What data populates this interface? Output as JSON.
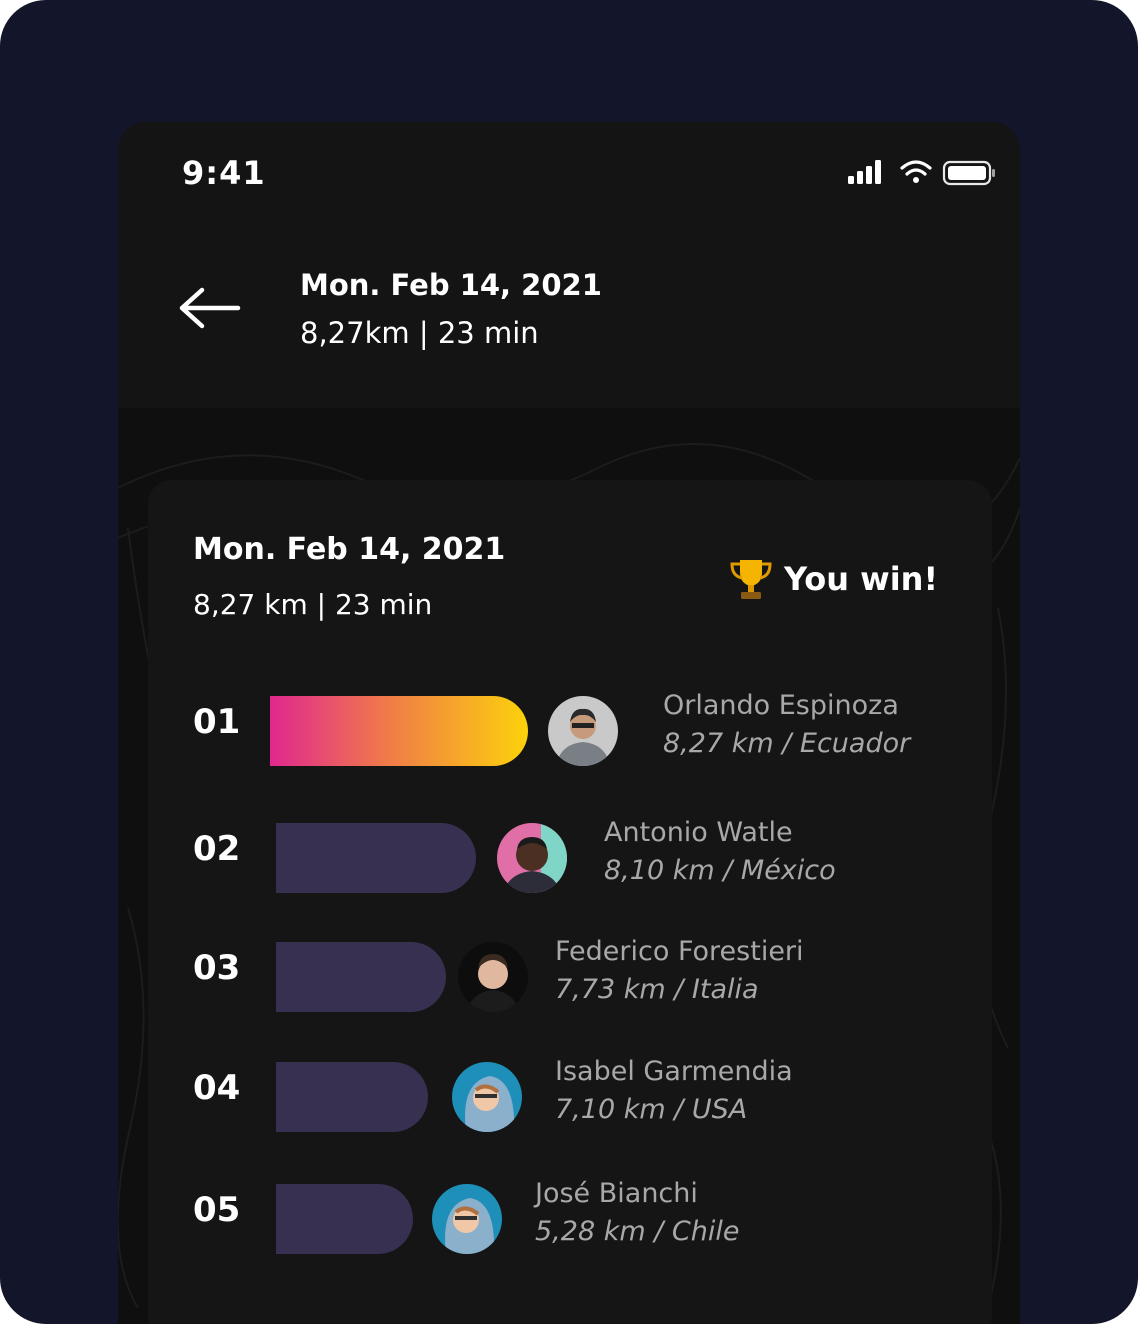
{
  "status_bar": {
    "time": "9:41"
  },
  "header": {
    "title": "Mon. Feb 14, 2021",
    "subtitle": "8,27km | 23 min"
  },
  "card": {
    "title": "Mon. Feb 14, 2021",
    "subtitle": "8,27 km | 23 min",
    "result_label": "You win!"
  },
  "leaderboard": [
    {
      "rank": "01",
      "name": "Orlando Espinoza",
      "info": "8,27 km / Ecuador"
    },
    {
      "rank": "02",
      "name": "Antonio Watle",
      "info": "8,10 km / México"
    },
    {
      "rank": "03",
      "name": "Federico Forestieri",
      "info": "7,73 km / Italia"
    },
    {
      "rank": "04",
      "name": "Isabel Garmendia",
      "info": "7,10 km / USA"
    },
    {
      "rank": "05",
      "name": "José Bianchi",
      "info": "5,28 km / Chile"
    }
  ],
  "colors": {
    "frame_background": "#13162a",
    "screen_background": "#131313",
    "bar_default": "#383050",
    "bar_gradient": [
      "#e0288f",
      "#f07a4a",
      "#fcd20a"
    ],
    "secondary_text": "#a8a8a8"
  },
  "icons": [
    "cellular-signal-icon",
    "wifi-icon",
    "battery-icon",
    "back-arrow-icon",
    "trophy-icon"
  ]
}
